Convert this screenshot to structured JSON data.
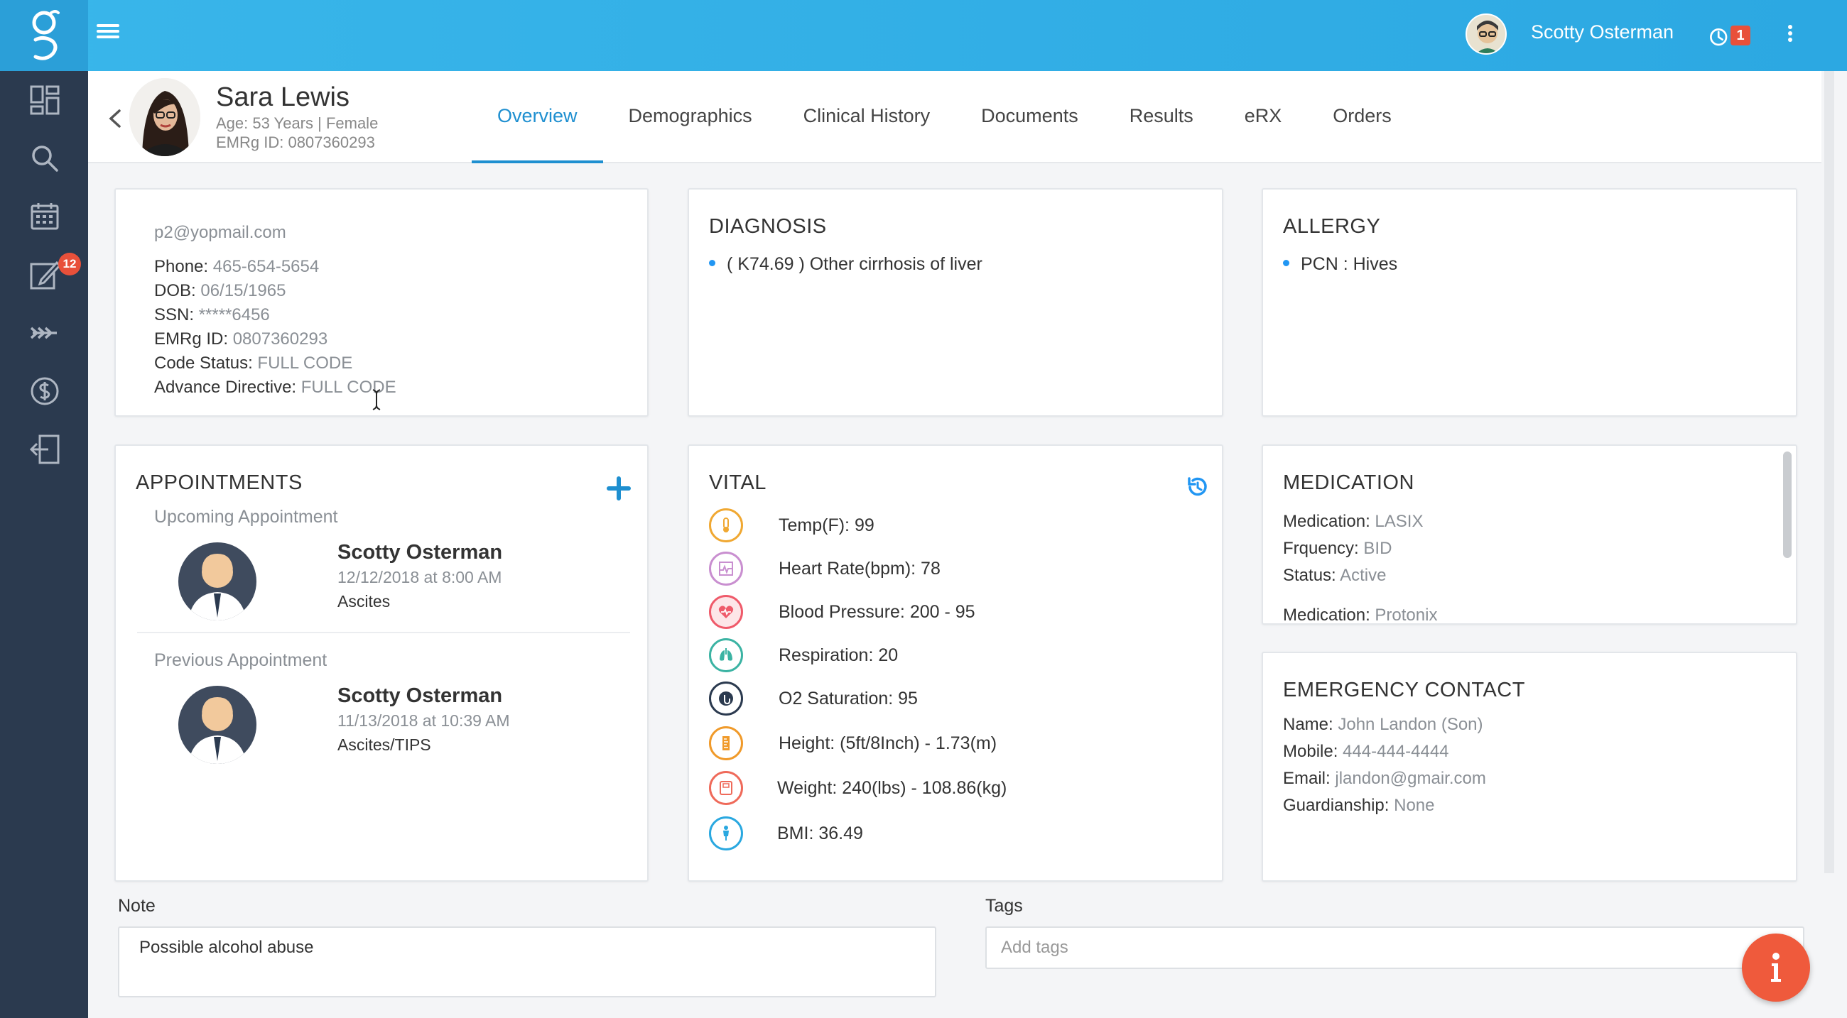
{
  "topbar": {
    "user_name": "Scotty Osterman",
    "notification_count": "1"
  },
  "sidebar": {
    "items": [
      {
        "icon": "dashboard-icon"
      },
      {
        "icon": "search-icon"
      },
      {
        "icon": "calendar-icon"
      },
      {
        "icon": "edit-icon",
        "badge": "12"
      },
      {
        "icon": "forward-icon"
      },
      {
        "icon": "dollar-icon"
      },
      {
        "icon": "logout-icon"
      }
    ]
  },
  "patient": {
    "name": "Sara Lewis",
    "age_gender": "Age: 53 Years | Female",
    "emrg_id": "EMRg ID: 0807360293"
  },
  "tabs": [
    {
      "label": "Overview",
      "active": true
    },
    {
      "label": "Demographics"
    },
    {
      "label": "Clinical History"
    },
    {
      "label": "Documents"
    },
    {
      "label": "Results"
    },
    {
      "label": "eRX"
    },
    {
      "label": "Orders"
    }
  ],
  "contact": {
    "email": "p2@yopmail.com",
    "phone_label": "Phone:",
    "phone": "465-654-5654",
    "dob_label": "DOB:",
    "dob": "06/15/1965",
    "ssn_label": "SSN:",
    "ssn": "*****6456",
    "emrg_label": "EMRg ID:",
    "emrg": "0807360293",
    "code_label": "Code Status:",
    "code": "FULL CODE",
    "directive_label": "Advance Directive:",
    "directive": "FULL CODE"
  },
  "diagnosis": {
    "title": "DIAGNOSIS",
    "items": [
      "( K74.69 ) Other cirrhosis of liver"
    ]
  },
  "allergy": {
    "title": "ALLERGY",
    "items": [
      "PCN : Hives"
    ]
  },
  "appointments": {
    "title": "APPOINTMENTS",
    "upcoming_label": "Upcoming Appointment",
    "upcoming": {
      "name": "Scotty Osterman",
      "date": "12/12/2018 at 8:00 AM",
      "reason": "Ascites"
    },
    "previous_label": "Previous Appointment",
    "previous": {
      "name": "Scotty Osterman",
      "date": "11/13/2018 at 10:39 AM",
      "reason": "Ascites/TIPS"
    }
  },
  "vital": {
    "title": "VITAL",
    "items": [
      {
        "text": "Temp(F): 99",
        "icon": "thermometer-icon",
        "color": "#f0a832"
      },
      {
        "text": "Heart Rate(bpm): 78",
        "icon": "heart-rate-icon",
        "color": "#c98fd0"
      },
      {
        "text": "Blood Pressure: 200 - 95",
        "icon": "blood-pressure-icon",
        "color": "#ef5a6a"
      },
      {
        "text": "Respiration: 20",
        "icon": "lungs-icon",
        "color": "#3bb3a3"
      },
      {
        "text": "O2 Saturation: 95",
        "icon": "o2-saturation-icon",
        "color": "#2b3a4f"
      },
      {
        "text": "Height: (5ft/8Inch) - 1.73(m)",
        "icon": "height-icon",
        "color": "#f09a2a"
      },
      {
        "text": "Weight: 240(lbs) - 108.86(kg)",
        "icon": "weight-icon",
        "color": "#ef6a5a"
      },
      {
        "text": "BMI: 36.49",
        "icon": "bmi-icon",
        "color": "#2aa8e0"
      }
    ]
  },
  "medication": {
    "title": "MEDICATION",
    "med_label": "Medication:",
    "med": "LASIX",
    "freq_label": "Frquency:",
    "freq": "BID",
    "status_label": "Status:",
    "status": "Active",
    "med2_label": "Medication:",
    "med2": "Protonix"
  },
  "emergency": {
    "title": "EMERGENCY CONTACT",
    "name_label": "Name:",
    "name": "John Landon (Son)",
    "mobile_label": "Mobile:",
    "mobile": "444-444-4444",
    "email_label": "Email:",
    "email": "jlandon@gmair.com",
    "guardian_label": "Guardianship:",
    "guardian": "None"
  },
  "note": {
    "label": "Note",
    "value": "Possible alcohol abuse"
  },
  "tags": {
    "label": "Tags",
    "placeholder": "Add tags"
  },
  "colors": {
    "brand": "#2ca8e2",
    "sidebar": "#2b3a4f",
    "accent": "#1e8fd0",
    "badge": "#e8503a"
  }
}
